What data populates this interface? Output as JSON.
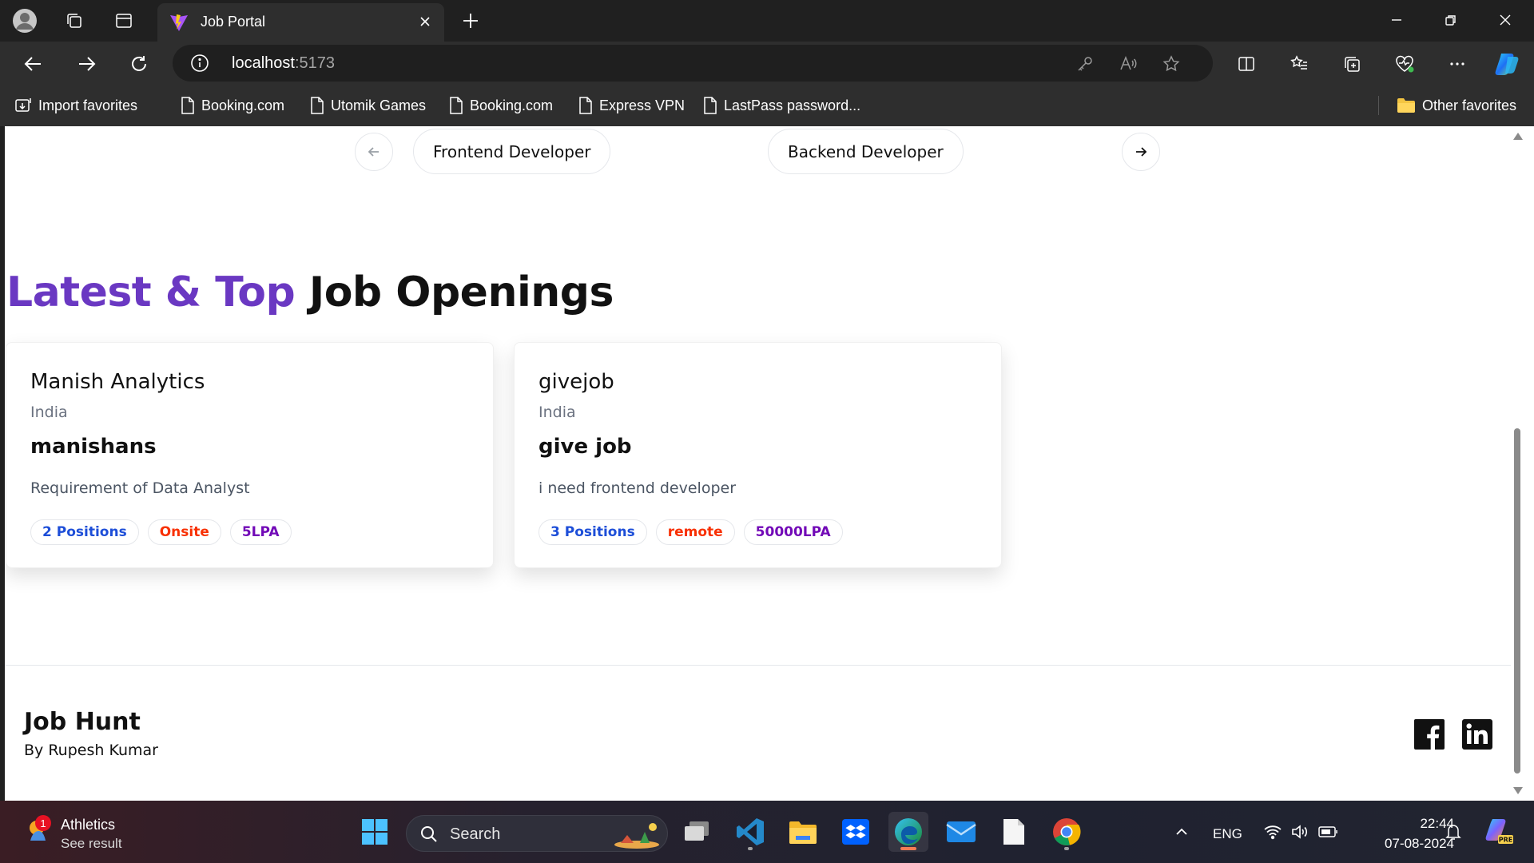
{
  "browser": {
    "tab_title": "Job Portal",
    "url_host": "localhost",
    "url_port": ":5173",
    "bookmarks": [
      {
        "label": "Import favorites",
        "icon": "import-icon"
      },
      {
        "label": "Booking.com",
        "icon": "page-icon"
      },
      {
        "label": "Utomik Games",
        "icon": "page-icon"
      },
      {
        "label": "Booking.com",
        "icon": "page-icon"
      },
      {
        "label": "Express VPN",
        "icon": "page-icon"
      },
      {
        "label": "LastPass password...",
        "icon": "page-icon"
      }
    ],
    "other_favorites": "Other favorites"
  },
  "carousel": {
    "items": [
      "Frontend Developer",
      "Backend Developer"
    ]
  },
  "section": {
    "heading_accent": "Latest & Top",
    "heading_rest": "Job Openings"
  },
  "jobs": [
    {
      "company": "Manish Analytics",
      "location": "India",
      "title": "manishans",
      "description": "Requirement of Data Analyst",
      "positions": "2 Positions",
      "job_type": "Onsite",
      "salary": "5LPA"
    },
    {
      "company": "givejob",
      "location": "India",
      "title": "give job",
      "description": "i need frontend developer",
      "positions": "3 Positions",
      "job_type": "remote",
      "salary": "50000LPA"
    }
  ],
  "footer": {
    "title": "Job Hunt",
    "subtitle": "By Rupesh Kumar"
  },
  "taskbar": {
    "weather_title": "Athletics",
    "weather_sub": "See result",
    "notification_count": "1",
    "search_placeholder": "Search",
    "language": "ENG",
    "time": "22:44",
    "date": "07-08-2024"
  },
  "colors": {
    "accent": "#6a38c2",
    "badge_blue": "#1d4ed8",
    "badge_red": "#f83002",
    "badge_purple": "#7209b7"
  }
}
